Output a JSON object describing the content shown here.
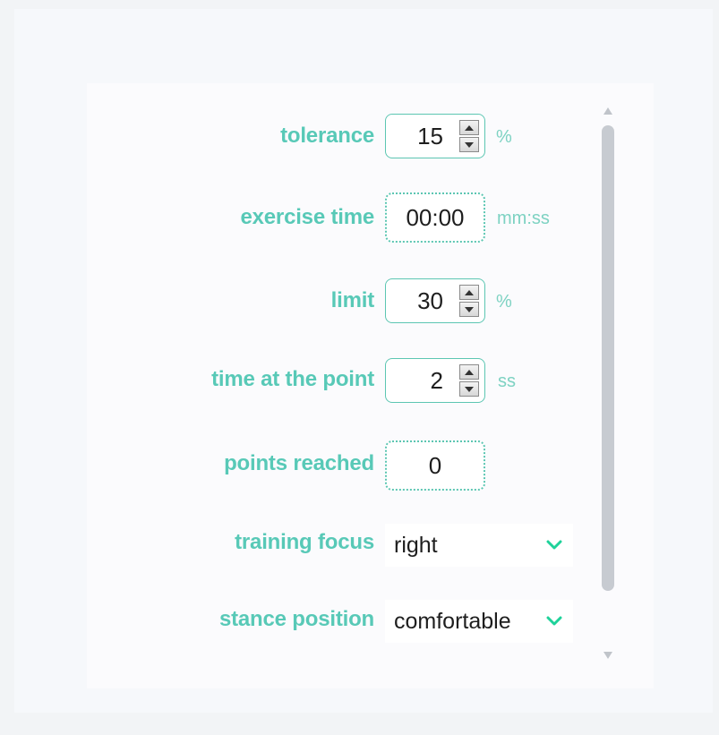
{
  "fields": {
    "tolerance": {
      "label": "tolerance",
      "value": "15",
      "unit": "%"
    },
    "exercise_time": {
      "label": "exercise time",
      "value": "00:00",
      "unit": "mm:ss"
    },
    "limit": {
      "label": "limit",
      "value": "30",
      "unit": "%"
    },
    "time_at_point": {
      "label": "time at the point",
      "value": "2",
      "unit": "ss"
    },
    "points_reached": {
      "label": "points reached",
      "value": "0"
    },
    "training_focus": {
      "label": "training focus",
      "selected": "right"
    },
    "stance_position": {
      "label": "stance position",
      "selected": "comfortable"
    }
  },
  "colors": {
    "accent": "#58c9b7",
    "border": "#5cc6b2",
    "chevron": "#1fd29a"
  },
  "icons": {
    "spin_up": "triangle-up-icon",
    "spin_down": "triangle-down-icon",
    "dropdown": "chevron-down-icon"
  }
}
